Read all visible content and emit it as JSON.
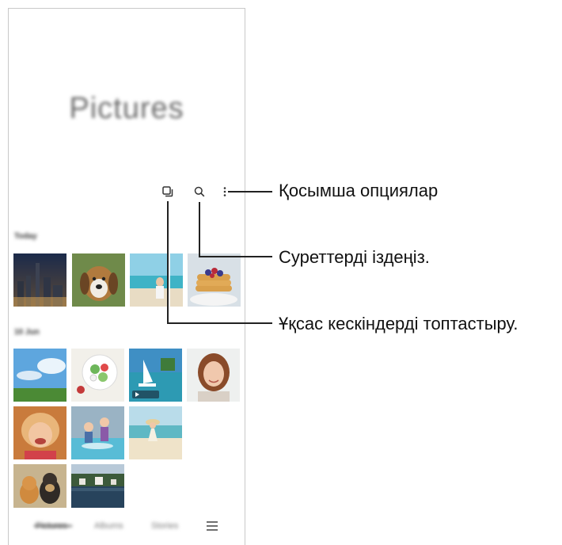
{
  "app": {
    "title": "Pictures",
    "sections": {
      "today": "Today",
      "earlier": "10 Jun"
    }
  },
  "toolbar": {
    "icons": [
      "group-similar-icon",
      "search-icon",
      "more-options-icon"
    ]
  },
  "bottom_nav": {
    "tabs": [
      "Pictures",
      "Albums",
      "Stories"
    ],
    "active_tab": "Pictures",
    "menu_icon": "hamburger-menu-icon"
  },
  "callouts": {
    "more_options": "Қосымша опциялар",
    "search": "Суреттерді іздеңіз.",
    "group_similar": "Ұқсас кескіндерді топтастыру."
  },
  "colors": {
    "callout_line": "#222222",
    "frame_border": "#c9c9c9"
  }
}
